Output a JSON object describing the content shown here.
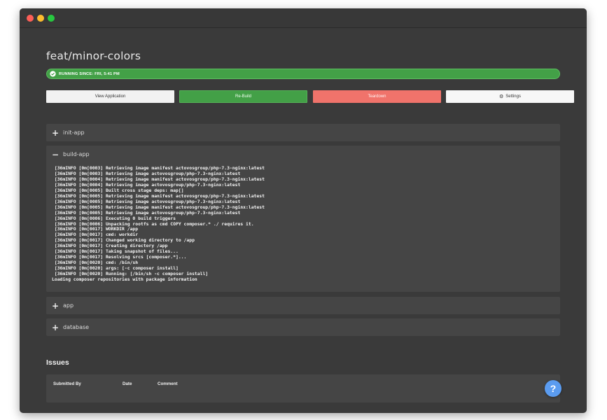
{
  "window": {
    "controls": [
      "close",
      "minimize",
      "zoom"
    ]
  },
  "branch": {
    "title": "feat/minor-colors"
  },
  "status": {
    "text": "RUNNING SINCE: FRI, 5:41 PM",
    "icon": "check-circle-icon",
    "color": "#43a047"
  },
  "actions": {
    "view_label": "View Application",
    "rebuild_label": "Re-Build",
    "teardown_label": "Teardown",
    "settings_label": "Settings",
    "settings_icon": "gear-icon",
    "colors": {
      "rebuild": "#43a047",
      "teardown": "#f0736b"
    }
  },
  "sections": [
    {
      "label": "init-app",
      "expanded": false,
      "toggle": "+"
    },
    {
      "label": "build-app",
      "expanded": true,
      "toggle": "−"
    },
    {
      "label": "app",
      "expanded": false,
      "toggle": "+"
    },
    {
      "label": "database",
      "expanded": false,
      "toggle": "+"
    }
  ],
  "build_log": [
    " [36mINFO [0m[0003] Retrieving image manifest actovosgroup/php-7.3-nginx:latest",
    " [36mINFO [0m[0003] Retrieving image actovosgroup/php-7.3-nginx:latest",
    " [36mINFO [0m[0004] Retrieving image manifest actovosgroup/php-7.3-nginx:latest",
    " [36mINFO [0m[0004] Retrieving image actovosgroup/php-7.3-nginx:latest",
    " [36mINFO [0m[0005] Built cross stage deps: map[]",
    " [36mINFO [0m[0005] Retrieving image manifest actovosgroup/php-7.3-nginx:latest",
    " [36mINFO [0m[0005] Retrieving image actovosgroup/php-7.3-nginx:latest",
    " [36mINFO [0m[0005] Retrieving image manifest actovosgroup/php-7.3-nginx:latest",
    " [36mINFO [0m[0005] Retrieving image actovosgroup/php-7.3-nginx:latest",
    " [36mINFO [0m[0006] Executing 0 build triggers",
    " [36mINFO [0m[0006] Unpacking rootfs as cmd COPY composer.* ./ requires it.",
    " [36mINFO [0m[0017] WORKDIR /app",
    " [36mINFO [0m[0017] cmd: workdir",
    " [36mINFO [0m[0017] Changed working directory to /app",
    " [36mINFO [0m[0017] Creating directory /app",
    " [36mINFO [0m[0017] Taking snapshot of files...",
    " [36mINFO [0m[0017] Resolving srcs [composer.*]...",
    " [36mINFO [0m[0020] cmd: /bin/sh",
    " [36mINFO [0m[0020] args: [-c composer install]",
    " [36mINFO [0m[0020] Running: [/bin/sh -c composer install]",
    "Loading composer repositories with package information"
  ],
  "issues": {
    "title": "Issues",
    "columns": [
      "Submitted By",
      "Date",
      "Comment"
    ]
  },
  "help": {
    "label": "?",
    "color": "#5b9cf0"
  }
}
